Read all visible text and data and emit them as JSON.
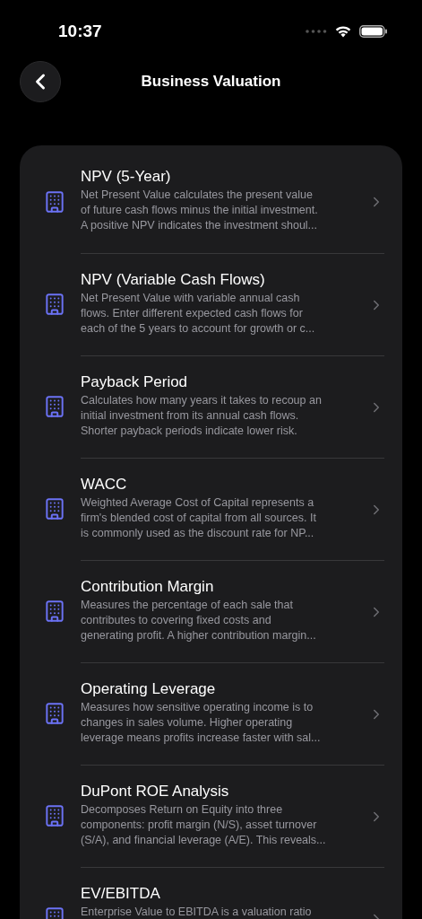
{
  "status_bar": {
    "time": "10:37"
  },
  "nav": {
    "title": "Business Valuation"
  },
  "items": [
    {
      "title": "NPV (5-Year)",
      "description_lines": [
        "Net Present Value calculates the present value",
        "of future cash flows minus the initial investment.",
        "A positive NPV indicates the investment shoul..."
      ]
    },
    {
      "title": "NPV (Variable Cash Flows)",
      "description_lines": [
        "Net Present Value with variable annual cash",
        "flows. Enter different expected cash flows for",
        "each of the 5 years to account for growth or c..."
      ]
    },
    {
      "title": "Payback Period",
      "description_lines": [
        "Calculates how many years it takes to recoup an",
        "initial investment from its annual cash flows.",
        "Shorter payback periods indicate lower risk."
      ]
    },
    {
      "title": "WACC",
      "description_lines": [
        "Weighted Average Cost of Capital represents a",
        "firm's blended cost of capital from all sources. It",
        "is commonly used as the discount rate for NP..."
      ]
    },
    {
      "title": "Contribution Margin",
      "description_lines": [
        "Measures the percentage of each sale that",
        "contributes to covering fixed costs and",
        "generating profit. A higher contribution margin..."
      ]
    },
    {
      "title": "Operating Leverage",
      "description_lines": [
        "Measures how sensitive operating income is to",
        "changes in sales volume. Higher operating",
        "leverage means profits increase faster with sal..."
      ]
    },
    {
      "title": "DuPont ROE Analysis",
      "description_lines": [
        "Decomposes Return on Equity into three",
        "components: profit margin (N/S), asset turnover",
        "(S/A), and financial leverage (A/E). This reveals..."
      ]
    },
    {
      "title": "EV/EBITDA",
      "description_lines": [
        "Enterprise Value to EBITDA is a valuation ratio"
      ]
    }
  ]
}
